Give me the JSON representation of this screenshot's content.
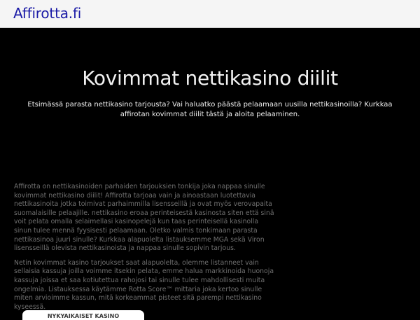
{
  "header": {
    "logo_text": "Affirotta.fi"
  },
  "hero": {
    "title": "Kovimmat nettikasino diilit",
    "lead": "Etsimässä parasta nettikasino tarjousta? Vai haluatko päästä pelaamaan uusilla nettikasinoilla? Kurkkaa affirotan kovimmat diilit tästä ja aloita pelaaminen."
  },
  "content": {
    "paragraphs": [
      "Affirotta on nettikasinoiden parhaiden tarjouksien tonkija joka nappaa sinulle kovimmat nettikasino diilit! Affirotta tarjoaa vain ja ainoastaan luotettavia nettikasinoita jotka toimivat parhaimmilla lisensseillä ja ovat myös verovapaita suomalaisille pelaajille. nettikasino eroaa perinteisestä kasinosta siten että sinä voit pelata omalla selaimellasi kasinopelejä kun taas perinteisellä kasinolla sinun tulee mennä fyysisesti pelaamaan. Oletko valmis tonkimaan parasta nettikasinoa juuri sinulle? Kurkkaa alapuolelta listauksemme MGA sekä Viron lisensseillä olevista nettikasinoista ja nappaa sinulle sopivin tarjous.",
      "Netin kovimmat kasino tarjoukset saat alapuolelta, olemme listanneet vain sellaisia kassuja joilla voimme itsekin pelata, emme halua markkinoida huonoja kassuja joissa et saa kotiutettua rahojosi tai sinulle tulee mahdollisesti muita ongelmia. Listauksessa käytämme Rotta Score™ mittaria joka kertoo sinulle miten arvioimme kassun, mitä korkeammat pisteet sitä parempi nettikasino kyseessä."
    ]
  },
  "cta": {
    "label": "NYKYAIKAISET KASINO"
  }
}
